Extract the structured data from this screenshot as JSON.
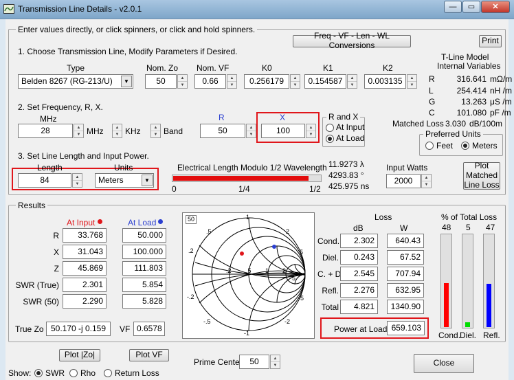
{
  "window": {
    "title": "Transmission Line Details - v2.0.1",
    "min": "—",
    "max": "▭",
    "close": "✕"
  },
  "intro": "Enter values directly, or click spinners, or click and hold spinners.",
  "buttons": {
    "conversions": "Freq - VF - Len - WL Conversions",
    "print": "Print",
    "plot_matched": "Plot Matched Line Loss",
    "plot_zo": "Plot |Zo|",
    "plot_vf": "Plot VF",
    "close": "Close"
  },
  "step1": {
    "label": "1. Choose Transmission Line, Modify Parameters if Desired.",
    "type_label": "Type",
    "type_value": "Belden 8267   (RG-213/U)",
    "nomzo_label": "Nom. Zo",
    "nomzo": "50",
    "nomvf_label": "Nom. VF",
    "nomvf": "0.66",
    "k0_label": "K0",
    "k0": "0.256179",
    "k1_label": "K1",
    "k1": "0.154587",
    "k2_label": "K2",
    "k2": "0.003135"
  },
  "tline": {
    "heading1": "T-Line Model",
    "heading2": "Internal Variables",
    "rows": [
      {
        "sym": "R",
        "val": "316.641",
        "unit": "mΩ/m"
      },
      {
        "sym": "L",
        "val": "254.414",
        "unit": "nH /m"
      },
      {
        "sym": "G",
        "val": "13.263",
        "unit": "μS /m"
      },
      {
        "sym": "C",
        "val": "101.080",
        "unit": "pF /m"
      }
    ],
    "matched_label": "Matched Loss",
    "matched_val": "3.030",
    "matched_unit": "dB/100m"
  },
  "units": {
    "title": "Preferred Units",
    "feet": "Feet",
    "meters": "Meters"
  },
  "step2": {
    "label": "2. Set Frequency, R, X.",
    "mhz_head": "MHz",
    "freq": "28",
    "mhz": "MHz",
    "khz": "KHz",
    "band": "Band",
    "r_label": "R",
    "r": "50",
    "x_label": "X",
    "x": "100"
  },
  "rx": {
    "title": "R and X",
    "at_input": "At Input",
    "at_load": "At Load"
  },
  "step3": {
    "label": "3. Set Line Length and Input Power.",
    "length_label": "Length",
    "length": "84",
    "units_label": "Units",
    "units_value": "Meters"
  },
  "elec": {
    "title": "Electrical Length Modulo 1/2 Wavelength",
    "tick0": "0",
    "tick1": "1/4",
    "tick2": "1/2",
    "fill": 0.92,
    "wavelengths": "11.9273 λ",
    "degrees": "4293.83 °",
    "time": "425.975 ns"
  },
  "input_watts": {
    "label": "Input Watts",
    "value": "2000"
  },
  "results": {
    "title": "Results",
    "at_input": "At Input",
    "at_load": "At Load",
    "rows": [
      {
        "label": "R",
        "input": "33.768",
        "load": "50.000"
      },
      {
        "label": "X",
        "input": "31.043",
        "load": "100.000"
      },
      {
        "label": "Z",
        "input": "45.869",
        "load": "111.803"
      },
      {
        "label": "SWR (True)",
        "input": "2.301",
        "load": "5.854"
      },
      {
        "label": "SWR   (50)",
        "input": "2.290",
        "load": "5.828"
      }
    ],
    "truezo_label": "True Zo",
    "truezo": "50.170 -j 0.159",
    "vf_label": "VF",
    "vf": "0.6578"
  },
  "smith": {
    "badge": "50",
    "labels": [
      ".2",
      ".5",
      "1",
      "2",
      "5",
      "-.2",
      "-.5",
      "-1",
      "-2",
      "-5",
      ".2",
      ".5",
      "1",
      "2",
      "5",
      "∞"
    ]
  },
  "loss": {
    "title": "Loss",
    "db": "dB",
    "w": "W",
    "rows": [
      {
        "label": "Cond.",
        "db": "2.302",
        "w": "640.43"
      },
      {
        "label": "Diel.",
        "db": "0.243",
        "w": "67.52"
      },
      {
        "label": "C. + D.",
        "db": "2.545",
        "w": "707.94"
      },
      {
        "label": "Refl.",
        "db": "2.276",
        "w": "632.95"
      },
      {
        "label": "Total",
        "db": "4.821",
        "w": "1340.90"
      }
    ],
    "power_label": "Power at Load",
    "power": "659.103"
  },
  "pct": {
    "title": "% of Total Loss",
    "bars": [
      {
        "label": "Cond.",
        "value": "48",
        "frac": 0.48,
        "color": "#ff0000"
      },
      {
        "label": "Diel.",
        "value": "5",
        "frac": 0.05,
        "color": "#00dd00"
      },
      {
        "label": "Refl.",
        "value": "47",
        "frac": 0.47,
        "color": "#0000ff"
      }
    ]
  },
  "prime": {
    "label": "Prime Center",
    "value": "50"
  },
  "show": {
    "label": "Show:",
    "swr": "SWR",
    "rho": "Rho",
    "rl": "Return Loss"
  }
}
